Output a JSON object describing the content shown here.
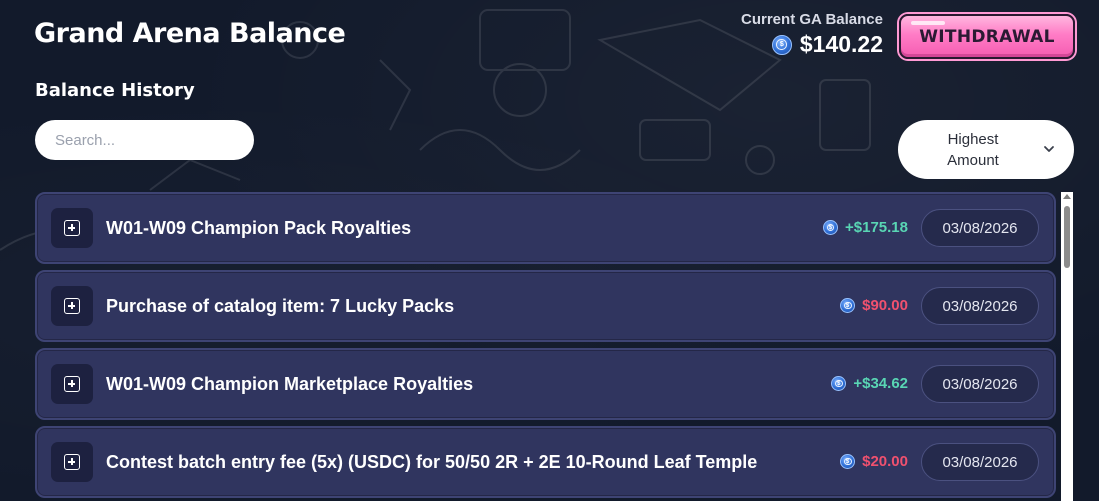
{
  "header": {
    "title": "Grand Arena Balance",
    "balance_label": "Current GA Balance",
    "balance_value": "$140.22",
    "balance_icon": "usdc-coin-icon",
    "withdraw_label": "WITHDRAWAL"
  },
  "history": {
    "title": "Balance History",
    "search_placeholder": "Search...",
    "sort_label": "Highest Amount"
  },
  "colors": {
    "positive": "#59d6b4",
    "negative": "#f0516f",
    "row_bg": "#30355f",
    "accent_pink": "#ff7cc6"
  },
  "transactions": [
    {
      "description": "W01-W09 Champion Pack Royalties",
      "amount": "+$175.18",
      "type": "positive",
      "date": "03/08/2026"
    },
    {
      "description": "Purchase of catalog item: 7 Lucky Packs",
      "amount": "$90.00",
      "type": "negative",
      "date": "03/08/2026"
    },
    {
      "description": "W01-W09 Champion Marketplace Royalties",
      "amount": "+$34.62",
      "type": "positive",
      "date": "03/08/2026"
    },
    {
      "description": "Contest batch entry fee (5x) (USDC) for 50/50 2R + 2E 10-Round Leaf Temple",
      "amount": "$20.00",
      "type": "negative",
      "date": "03/08/2026"
    }
  ]
}
